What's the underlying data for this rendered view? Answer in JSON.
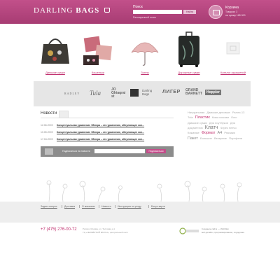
{
  "header": {
    "logo_part1": "DARLING",
    "logo_part2": "BAGS",
    "search_label": "Поиск",
    "search_button": "Найти",
    "search_extended": "Расширенный поиск",
    "cart_title": "Корзина",
    "cart_line1": "Товаров: 3",
    "cart_line2": "на сумму 165 000"
  },
  "categories": [
    {
      "label": "Дамские сумки"
    },
    {
      "label": "Кошельки"
    },
    {
      "label": "Зонты"
    },
    {
      "label": "Дорожные сумки"
    },
    {
      "label": "Каталог украшений"
    }
  ],
  "brands": [
    "RADLEY",
    "Tula",
    "JO Ghiaqrai st",
    "Darling Bags",
    "ЛИГЕР",
    "GRAND BARNETT",
    "Hoppler"
  ],
  "news": {
    "title": "Новости",
    "items": [
      {
        "date": "12.06.2009",
        "title": "Концептуальная уравнение Эйлера – это уравнение, обнуляющее кон..."
      },
      {
        "date": "10.05.2009",
        "title": "Концептуальная уравнение Эйлера – это уравнение, обнуляющее кон..."
      },
      {
        "date": "17.04.2009",
        "title": "Концептуальная уравнение Эйлера – это уравнение, обнуляющее кон..."
      }
    ]
  },
  "subscribe": {
    "label": "Подписаться на новости",
    "button": "Подписаться"
  },
  "tags": [
    {
      "text": "Натуральная",
      "size": "sm"
    },
    {
      "text": "Дамские деловые",
      "size": "sm"
    },
    {
      "text": "Ралли-13",
      "size": "sm"
    },
    {
      "text": "Tula",
      "size": "sm"
    },
    {
      "text": "Пластик",
      "size": "md"
    },
    {
      "text": "Кожа кожзам",
      "size": "sm"
    },
    {
      "text": "Лого",
      "size": "sm"
    },
    {
      "text": "Дамские сумки",
      "size": "sm"
    },
    {
      "text": "Для ноутбуков",
      "size": "sm"
    },
    {
      "text": "Для документов",
      "size": "sm"
    },
    {
      "text": "Клатч",
      "size": "lg"
    },
    {
      "text": "Через плечо",
      "size": "sm"
    },
    {
      "text": "Кожаные",
      "size": "sm"
    },
    {
      "text": "Формат",
      "size": "md"
    },
    {
      "text": "А4",
      "size": "mdg"
    },
    {
      "text": "Рюкзаки",
      "size": "sm"
    },
    {
      "text": "Пакет",
      "size": "mdg"
    },
    {
      "text": "Большие",
      "size": "sm"
    },
    {
      "text": "Вечерние",
      "size": "sm"
    },
    {
      "text": "Портфели",
      "size": "sm"
    }
  ],
  "footer": {
    "links": [
      "Задать вопрос",
      "Доставка",
      "О магазине",
      "Новости",
      "Инструкция по уходу",
      "Бонус-карта"
    ],
    "phone": "+7 (475) 276-00-72",
    "address_line1": "Россия, Москва, ул. Тестовая д.1",
    "address_line2": "ТЦ «ЧЕТВЁРТЫЙ ВАГОН», центральный холл",
    "studio_line1": "Создание сайта — WebMan",
    "studio_line2": "веб-дизайн, программирование, поддержка"
  },
  "colors": {
    "brand": "#b2477f",
    "accent_link": "#c02e6e",
    "band": "#e6e6e6"
  }
}
